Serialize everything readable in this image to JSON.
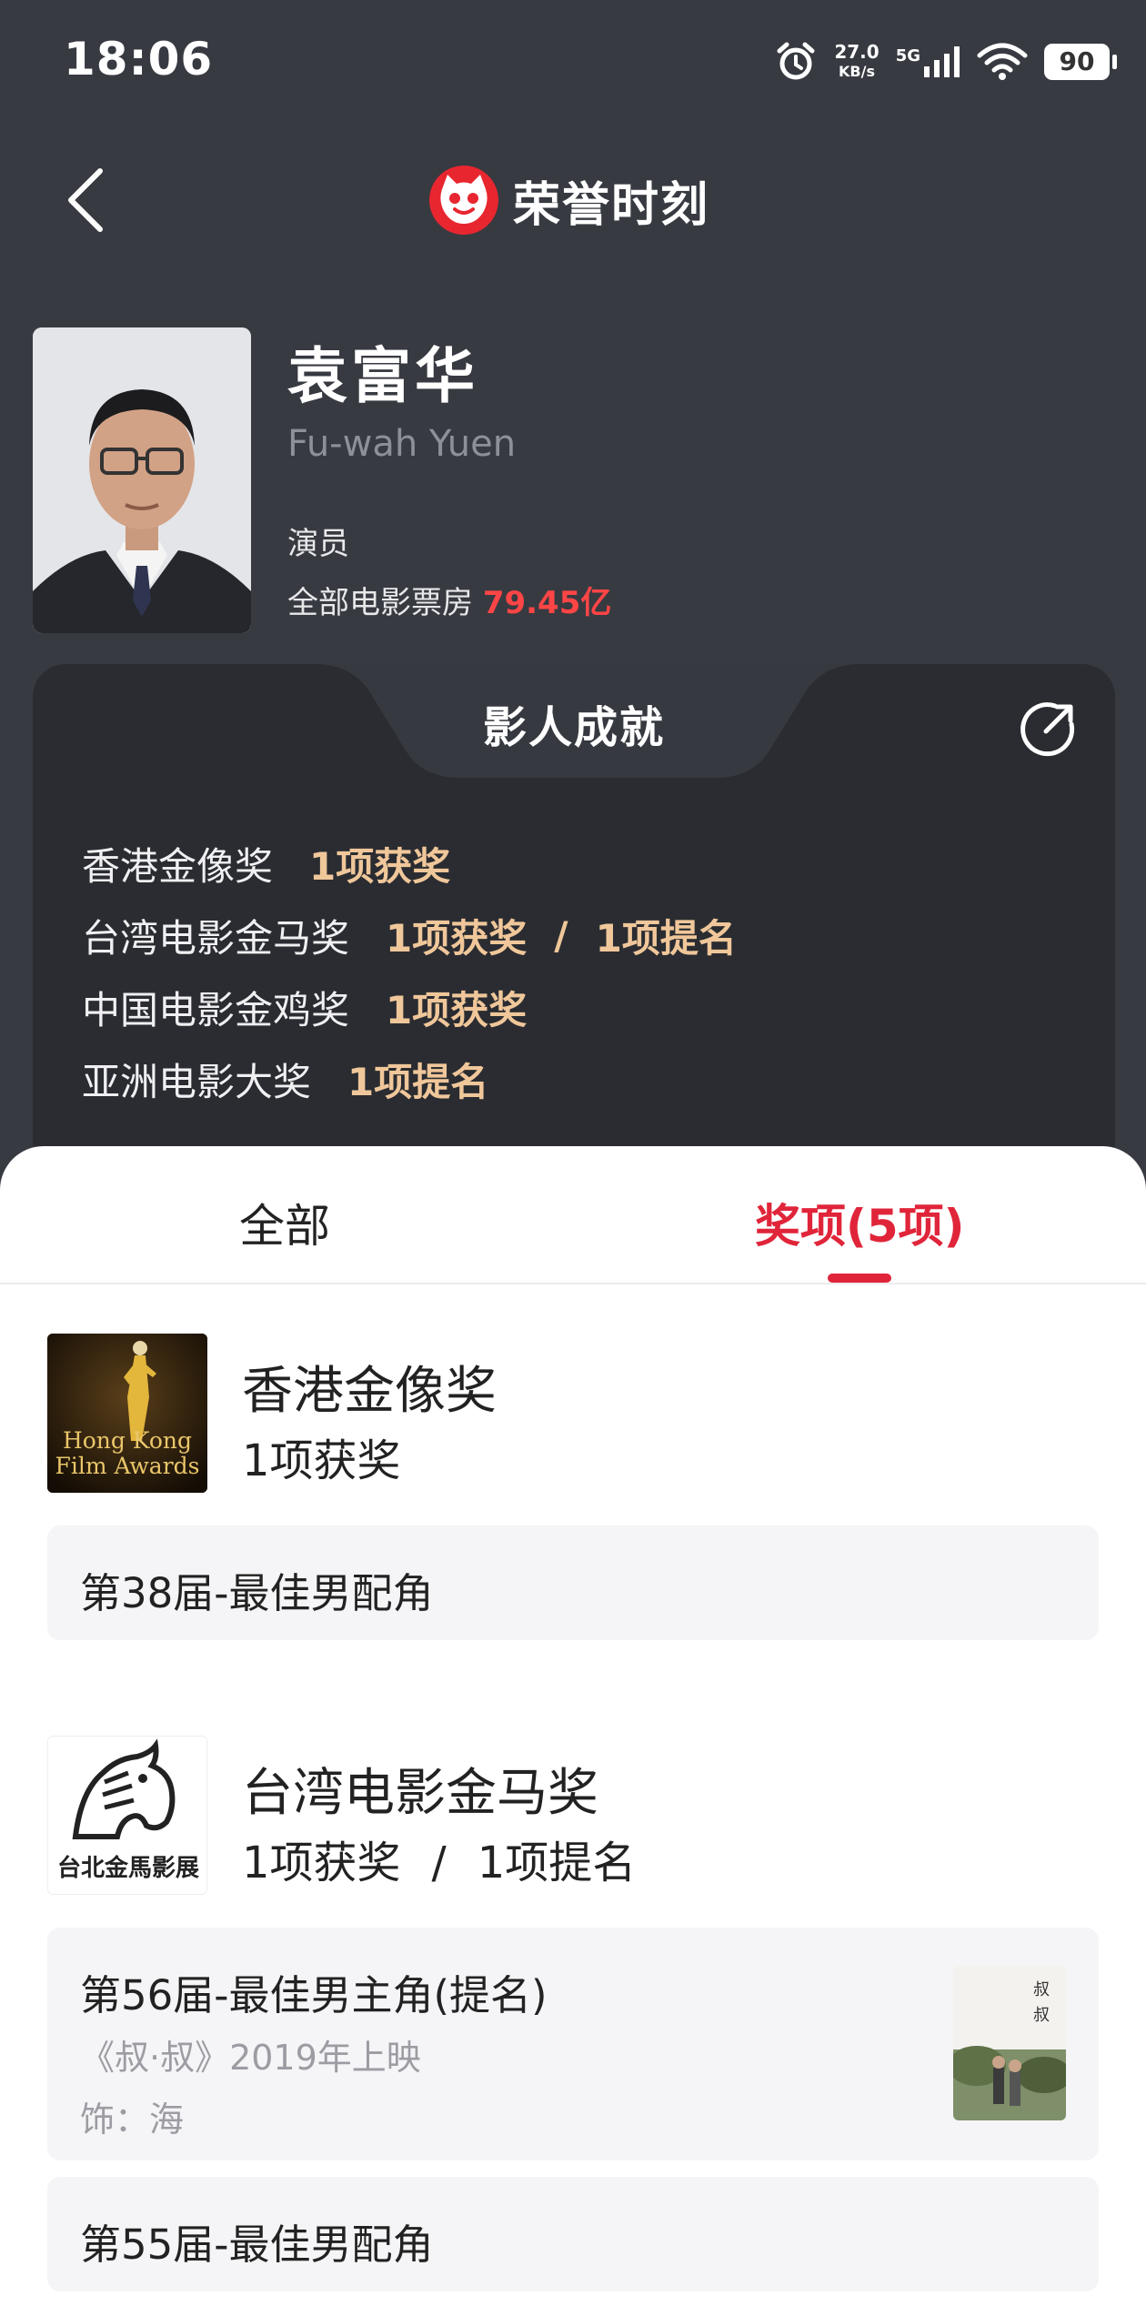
{
  "status_bar": {
    "time": "18:06",
    "net_speed_value": "27.0",
    "net_speed_unit": "KB/s",
    "network": "5G",
    "battery": "90"
  },
  "header": {
    "title": "荣誉时刻"
  },
  "profile": {
    "name": "袁富华",
    "english_name": "Fu-wah Yuen",
    "role": "演员",
    "box_office_label": "全部电影票房",
    "box_office_value": "79.45亿"
  },
  "achievements": {
    "title": "影人成就",
    "rows": [
      {
        "name": "香港金像奖",
        "won": "1项获奖",
        "sep": "",
        "nominated": ""
      },
      {
        "name": "台湾电影金马奖",
        "won": "1项获奖",
        "sep": "/",
        "nominated": "1项提名"
      },
      {
        "name": "中国电影金鸡奖",
        "won": "1项获奖",
        "sep": "",
        "nominated": ""
      },
      {
        "name": "亚洲电影大奖",
        "won": "1项提名",
        "sep": "",
        "nominated": ""
      }
    ]
  },
  "tabs": {
    "all": "全部",
    "awards": "奖项(5项)"
  },
  "award_groups": [
    {
      "name": "香港金像奖",
      "logo_text_1": "Hong Kong",
      "logo_text_2": "Film Awards",
      "won": "1项获奖",
      "items": [
        {
          "title": "第38届-最佳男配角"
        }
      ]
    },
    {
      "name": "台湾电影金马奖",
      "logo_text_1": "台北金馬影展",
      "won": "1项获奖",
      "sep": "/",
      "nominated": "1项提名",
      "items": [
        {
          "title": "第56届-最佳男主角(提名)",
          "film": "《叔·叔》2019年上映",
          "character": "饰：海"
        },
        {
          "title": "第55届-最佳男配角"
        }
      ]
    }
  ],
  "colors": {
    "background_dark": "#373a41",
    "card_dark": "#2a2c31",
    "accent_red": "#e0253a",
    "box_office_red": "#ff4545",
    "gold": "#f0c79a"
  }
}
